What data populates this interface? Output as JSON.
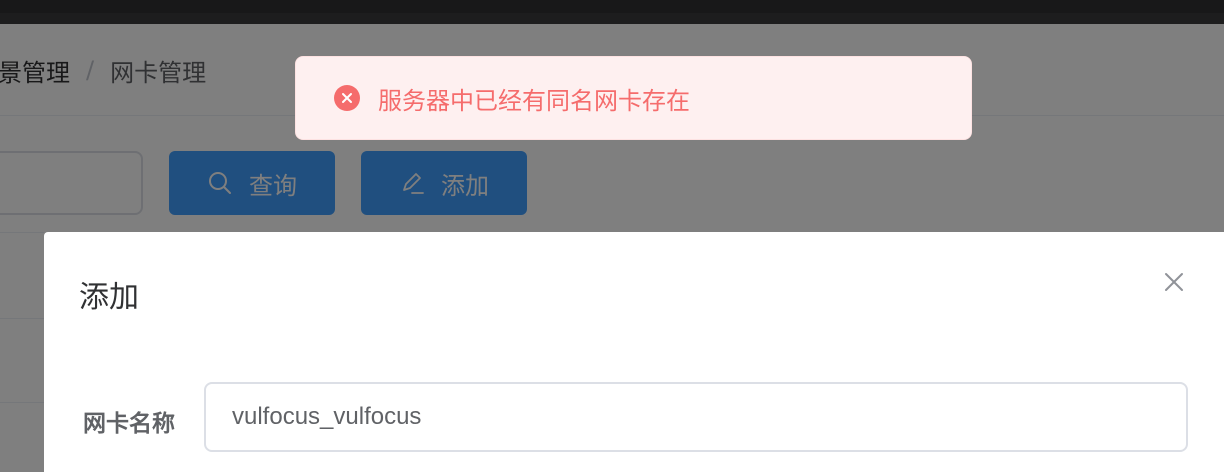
{
  "breadcrumb": {
    "parent": "景管理",
    "separator": "/",
    "current": "网卡管理"
  },
  "toolbar": {
    "query_label": "查询",
    "query_icon": "search-icon",
    "add_label": "添加",
    "add_icon": "edit-icon"
  },
  "message": {
    "type": "error",
    "icon": "error-circle-icon",
    "text": "服务器中已经有同名网卡存在"
  },
  "dialog": {
    "title": "添加",
    "close_icon": "close-icon",
    "field_label": "网卡名称",
    "field_value": "vulfocus_vulfocus"
  },
  "colors": {
    "primary": "#409eff",
    "error": "#f56c6c",
    "error_bg": "#fef0f0",
    "mask": "rgba(0,0,0,0.5)"
  }
}
